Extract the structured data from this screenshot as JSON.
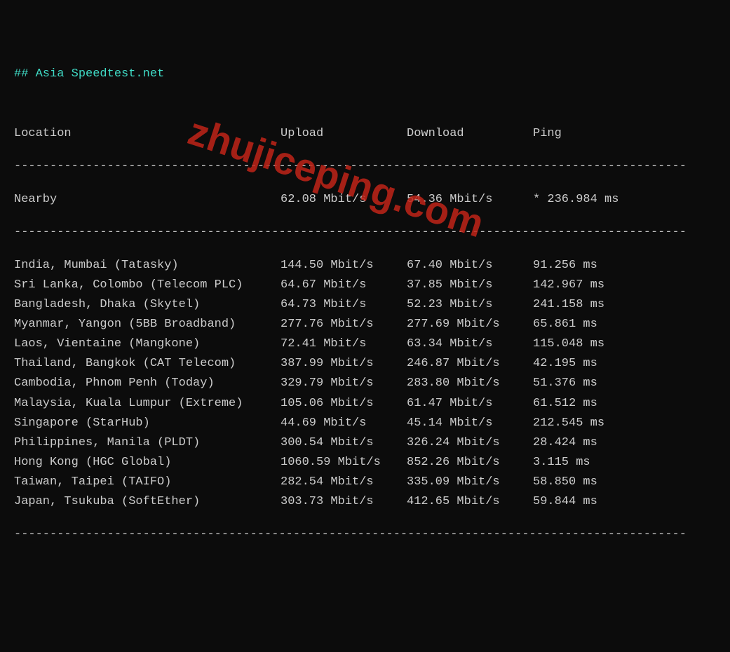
{
  "title": "## Asia Speedtest.net",
  "headers": {
    "location": "Location",
    "upload": "Upload",
    "download": "Download",
    "ping": "Ping"
  },
  "nearby": {
    "location": "Nearby",
    "upload": "62.08 Mbit/s",
    "download": "54.36 Mbit/s",
    "ping": "* 236.984 ms"
  },
  "rows": [
    {
      "location": "India, Mumbai (Tatasky)",
      "upload": "144.50 Mbit/s",
      "download": "67.40 Mbit/s",
      "ping": "91.256 ms"
    },
    {
      "location": "Sri Lanka, Colombo (Telecom PLC)",
      "upload": "64.67 Mbit/s",
      "download": "37.85 Mbit/s",
      "ping": "142.967 ms"
    },
    {
      "location": "Bangladesh, Dhaka (Skytel)",
      "upload": "64.73 Mbit/s",
      "download": "52.23 Mbit/s",
      "ping": "241.158 ms"
    },
    {
      "location": "Myanmar, Yangon (5BB Broadband)",
      "upload": "277.76 Mbit/s",
      "download": "277.69 Mbit/s",
      "ping": "65.861 ms"
    },
    {
      "location": "Laos, Vientaine (Mangkone)",
      "upload": "72.41 Mbit/s",
      "download": "63.34 Mbit/s",
      "ping": "115.048 ms"
    },
    {
      "location": "Thailand, Bangkok (CAT Telecom)",
      "upload": "387.99 Mbit/s",
      "download": "246.87 Mbit/s",
      "ping": "42.195 ms"
    },
    {
      "location": "Cambodia, Phnom Penh (Today)",
      "upload": "329.79 Mbit/s",
      "download": "283.80 Mbit/s",
      "ping": "51.376 ms"
    },
    {
      "location": "Malaysia, Kuala Lumpur (Extreme)",
      "upload": "105.06 Mbit/s",
      "download": "61.47 Mbit/s",
      "ping": "61.512 ms"
    },
    {
      "location": "Singapore (StarHub)",
      "upload": "44.69 Mbit/s",
      "download": "45.14 Mbit/s",
      "ping": "212.545 ms"
    },
    {
      "location": "Philippines, Manila (PLDT)",
      "upload": "300.54 Mbit/s",
      "download": "326.24 Mbit/s",
      "ping": "28.424 ms"
    },
    {
      "location": "Hong Kong (HGC Global)",
      "upload": "1060.59 Mbit/s",
      "download": "852.26 Mbit/s",
      "ping": "3.115 ms"
    },
    {
      "location": "Taiwan, Taipei (TAIFO)",
      "upload": "282.54 Mbit/s",
      "download": "335.09 Mbit/s",
      "ping": "58.850 ms"
    },
    {
      "location": "Japan, Tsukuba (SoftEther)",
      "upload": "303.73 Mbit/s",
      "download": "412.65 Mbit/s",
      "ping": "59.844 ms"
    }
  ],
  "divider": "----------------------------------------------------------------------------------------------",
  "watermark": "zhujiceping.com",
  "chart_data": {
    "type": "table",
    "title": "Asia Speedtest.net",
    "columns": [
      "Location",
      "Upload (Mbit/s)",
      "Download (Mbit/s)",
      "Ping (ms)"
    ],
    "rows": [
      [
        "Nearby",
        62.08,
        54.36,
        236.984
      ],
      [
        "India, Mumbai (Tatasky)",
        144.5,
        67.4,
        91.256
      ],
      [
        "Sri Lanka, Colombo (Telecom PLC)",
        64.67,
        37.85,
        142.967
      ],
      [
        "Bangladesh, Dhaka (Skytel)",
        64.73,
        52.23,
        241.158
      ],
      [
        "Myanmar, Yangon (5BB Broadband)",
        277.76,
        277.69,
        65.861
      ],
      [
        "Laos, Vientaine (Mangkone)",
        72.41,
        63.34,
        115.048
      ],
      [
        "Thailand, Bangkok (CAT Telecom)",
        387.99,
        246.87,
        42.195
      ],
      [
        "Cambodia, Phnom Penh (Today)",
        329.79,
        283.8,
        51.376
      ],
      [
        "Malaysia, Kuala Lumpur (Extreme)",
        105.06,
        61.47,
        61.512
      ],
      [
        "Singapore (StarHub)",
        44.69,
        45.14,
        212.545
      ],
      [
        "Philippines, Manila (PLDT)",
        300.54,
        326.24,
        28.424
      ],
      [
        "Hong Kong (HGC Global)",
        1060.59,
        852.26,
        3.115
      ],
      [
        "Taiwan, Taipei (TAIFO)",
        282.54,
        335.09,
        58.85
      ],
      [
        "Japan, Tsukuba (SoftEther)",
        303.73,
        412.65,
        59.844
      ]
    ]
  }
}
